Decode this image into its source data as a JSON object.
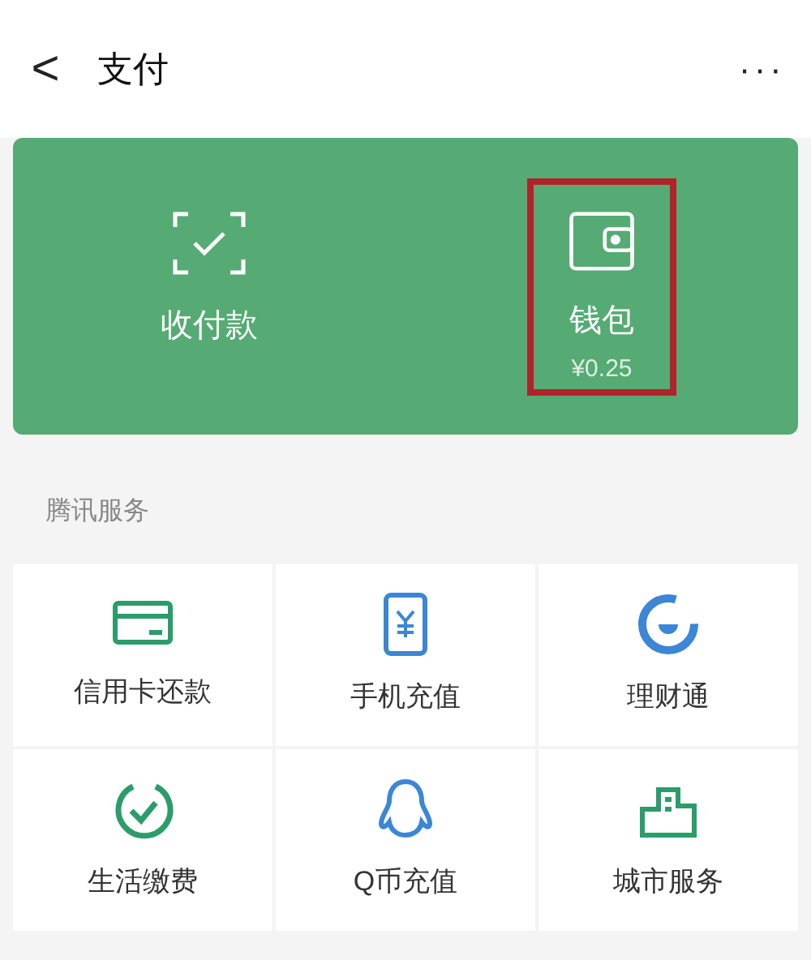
{
  "header": {
    "back": "<",
    "title": "支付",
    "more": "···"
  },
  "card": {
    "items": [
      {
        "kind": "scan",
        "label": "收付款",
        "highlighted": false
      },
      {
        "kind": "wallet",
        "label": "钱包",
        "amount": "¥0.25",
        "highlighted": true
      }
    ]
  },
  "section": {
    "title": "腾讯服务",
    "items": [
      {
        "kind": "card",
        "label": "信用卡还款"
      },
      {
        "kind": "phone",
        "label": "手机充值"
      },
      {
        "kind": "finance",
        "label": "理财通"
      },
      {
        "kind": "utility",
        "label": "生活缴费"
      },
      {
        "kind": "qq",
        "label": "Q币充值"
      },
      {
        "kind": "city",
        "label": "城市服务"
      }
    ]
  }
}
